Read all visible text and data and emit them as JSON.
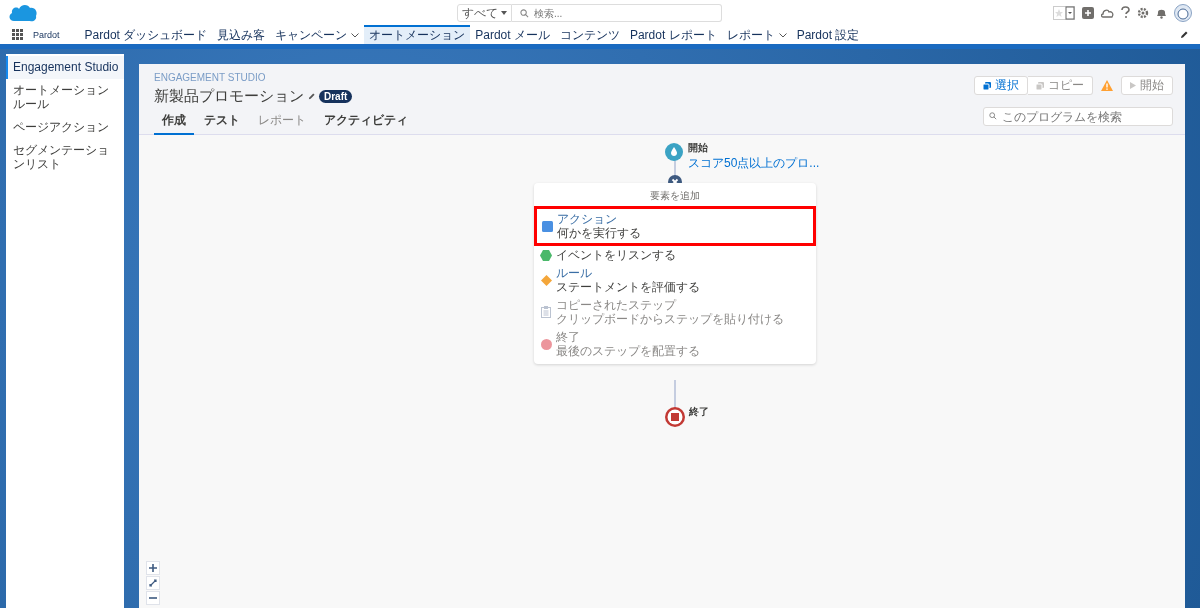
{
  "header": {
    "search_scope": "すべて",
    "search_placeholder": "検索..."
  },
  "nav": {
    "app_name": "Pardot",
    "items": [
      {
        "label": "Pardot ダッシュボード",
        "selected": false,
        "dropdown": false
      },
      {
        "label": "見込み客",
        "selected": false,
        "dropdown": false
      },
      {
        "label": "キャンペーン",
        "selected": false,
        "dropdown": true
      },
      {
        "label": "オートメーション",
        "selected": true,
        "dropdown": false
      },
      {
        "label": "Pardot メール",
        "selected": false,
        "dropdown": false
      },
      {
        "label": "コンテンツ",
        "selected": false,
        "dropdown": false
      },
      {
        "label": "Pardot レポート",
        "selected": false,
        "dropdown": false
      },
      {
        "label": "レポート",
        "selected": false,
        "dropdown": true
      },
      {
        "label": "Pardot 設定",
        "selected": false,
        "dropdown": false
      }
    ]
  },
  "sidebar": {
    "items": [
      {
        "label": "Engagement Studio",
        "selected": true
      },
      {
        "label": "オートメーションルール",
        "selected": false
      },
      {
        "label": "ページアクション",
        "selected": false
      },
      {
        "label": "セグメンテーションリスト",
        "selected": false
      }
    ]
  },
  "program": {
    "eyebrow": "ENGAGEMENT STUDIO",
    "title": "新製品プロモーション",
    "badge": "Draft",
    "tabs": [
      {
        "label": "作成",
        "selected": true,
        "disabled": false
      },
      {
        "label": "テスト",
        "selected": false,
        "disabled": false
      },
      {
        "label": "レポート",
        "selected": false,
        "disabled": true
      },
      {
        "label": "アクティビティ",
        "selected": false,
        "disabled": false
      }
    ],
    "buttons": [
      {
        "label": "選択",
        "disabled": false
      },
      {
        "label": "コピー",
        "disabled": true
      },
      {
        "label": "開始",
        "disabled": true
      }
    ],
    "search_placeholder": "このプログラムを検索"
  },
  "canvas": {
    "start": {
      "title": "開始",
      "subtitle": "スコア50点以上のプロ..."
    },
    "menu": {
      "heading": "要素を追加",
      "items": [
        {
          "kind": "action",
          "title": "アクション",
          "description": "何かを実行する",
          "disabled": false,
          "highlighted": true
        },
        {
          "kind": "trigger",
          "description": "イベントをリスンする",
          "disabled": false,
          "highlighted": false
        },
        {
          "kind": "rule",
          "title": "ルール",
          "description": "ステートメントを評価する",
          "disabled": false,
          "highlighted": false
        },
        {
          "kind": "copied",
          "title": "コピーされたステップ",
          "description": "クリップボードからステップを貼り付ける",
          "disabled": true,
          "highlighted": false
        },
        {
          "kind": "end",
          "title": "終了",
          "description": "最後のステップを配置する",
          "disabled": true,
          "highlighted": false
        }
      ]
    },
    "end": {
      "title": "終了"
    }
  }
}
